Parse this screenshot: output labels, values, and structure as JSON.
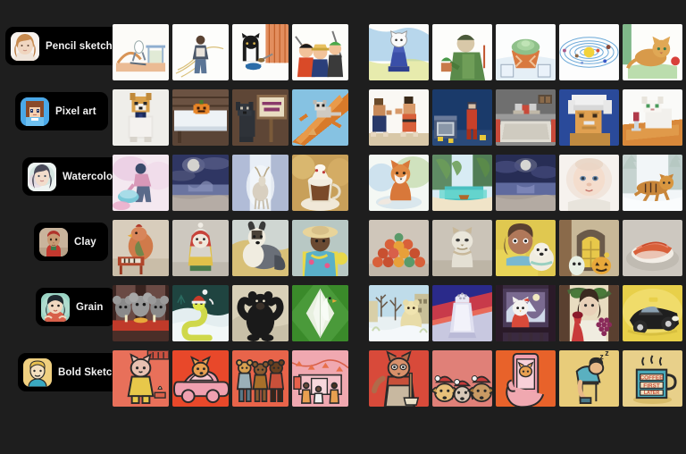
{
  "app": {
    "background_color": "#1e1e1e",
    "chip_background": "#000000",
    "chip_text_color": "#f2f2f2"
  },
  "rows": [
    {
      "id": "pencil-sketch",
      "label": "Pencil sketch",
      "avatar_name": "woman-portrait-pencil-avatar",
      "left_images": [
        {
          "caption": "skateboarder on ramp"
        },
        {
          "caption": "man standing on stairs"
        },
        {
          "caption": "tuxedo cat with food bowl"
        },
        {
          "caption": "anime pirate crew trio"
        }
      ],
      "right_images": [
        {
          "caption": "cat on chess piece"
        },
        {
          "caption": "man in green coat holding plant"
        },
        {
          "caption": "succulent in terracotta pot"
        },
        {
          "caption": "solar system orbit diagram"
        },
        {
          "caption": "orange tabby kitten with yarn"
        }
      ]
    },
    {
      "id": "pixel-art",
      "label": "Pixel art",
      "avatar_name": "anime-girl-pixel-avatar",
      "left_images": [
        {
          "caption": "shiba inu in tuxedo"
        },
        {
          "caption": "jack-o-lantern on snowy table"
        },
        {
          "caption": "black dog beside VOICE CHAT sign",
          "text": "VOICE CHAT"
        },
        {
          "caption": "sugar glider on autumn branch"
        }
      ],
      "right_images": [
        {
          "caption": "two fighters sparring"
        },
        {
          "caption": "person in red suit with old tv"
        },
        {
          "caption": "grey room interior scene"
        },
        {
          "caption": "einstein portrait"
        },
        {
          "caption": "white cat with wine glass"
        }
      ]
    },
    {
      "id": "watercolor",
      "label": "Watercolor",
      "avatar_name": "woman-portrait-watercolor-avatar",
      "left_images": [
        {
          "caption": "person washing laundry in basin"
        },
        {
          "caption": "moonlit beach at night"
        },
        {
          "caption": "deer in misty forest"
        },
        {
          "caption": "whipped cream latte in mug"
        }
      ],
      "right_images": [
        {
          "caption": "red fox sitting"
        },
        {
          "caption": "tropical lagoon with boat"
        },
        {
          "caption": "moonlit seascape"
        },
        {
          "caption": "baby portrait"
        },
        {
          "caption": "tiger running in snow"
        }
      ]
    },
    {
      "id": "clay",
      "label": "Clay",
      "avatar_name": "man-red-shirt-clay-avatar",
      "left_images": [
        {
          "caption": "clay chicken at piano"
        },
        {
          "caption": "clay santa claus figure"
        },
        {
          "caption": "clay collie dog"
        },
        {
          "caption": "clay figure with straw hat"
        }
      ],
      "right_images": [
        {
          "caption": "pile of clay people"
        },
        {
          "caption": "clay cat figure"
        },
        {
          "caption": "clay woman with poodle"
        },
        {
          "caption": "clay ghost and pumpkin doorway"
        },
        {
          "caption": "clay tuna nigiri sushi"
        }
      ]
    },
    {
      "id": "grain",
      "label": "Grain",
      "avatar_name": "woman-teal-grain-avatar",
      "left_images": [
        {
          "caption": "mice at dinner table"
        },
        {
          "caption": "snake in santa hat on snow"
        },
        {
          "caption": "black bear flexing arms"
        },
        {
          "caption": "white bird among green leaves"
        }
      ],
      "right_images": [
        {
          "caption": "polar bear in winter town"
        },
        {
          "caption": "salt shaker still life"
        },
        {
          "caption": "cat figure by window with mountain"
        },
        {
          "caption": "figure with wine and grapes"
        },
        {
          "caption": "black taxi on yellow background"
        }
      ]
    },
    {
      "id": "bold-sketch",
      "label": "Bold Sketch",
      "avatar_name": "blond-man-bold-sketch-avatar",
      "left_images": [
        {
          "caption": "cat in yellow sweater"
        },
        {
          "caption": "dog driving pink car"
        },
        {
          "caption": "three bears standing"
        },
        {
          "caption": "people at market stalls"
        }
      ],
      "right_images": [
        {
          "caption": "fox with broom"
        },
        {
          "caption": "three dogs in santa hats"
        },
        {
          "caption": "hand holding phone with cat photo"
        },
        {
          "caption": "tired person slumped on chair",
          "text": "z z"
        },
        {
          "caption": "coffee mug with slogan",
          "text": "COFFEE FIRST LATER"
        }
      ]
    }
  ]
}
